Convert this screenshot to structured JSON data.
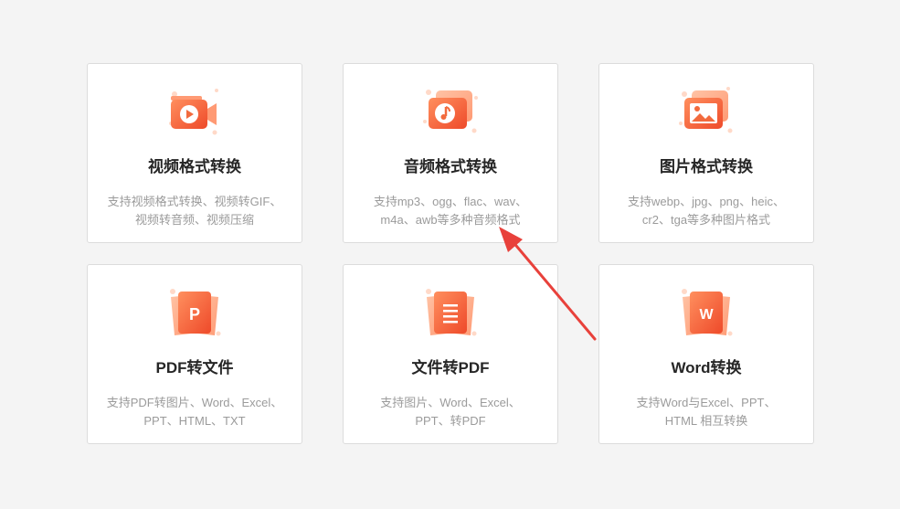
{
  "accent": "#f26a3d",
  "cards": [
    {
      "title": "视频格式转换",
      "desc": [
        "支持视频格式转换、视频转GIF、",
        "视频转音频、视频压缩"
      ],
      "icon": "video-icon"
    },
    {
      "title": "音频格式转换",
      "desc": [
        "支持mp3、ogg、flac、wav、",
        "m4a、awb等多种音频格式"
      ],
      "icon": "music-note-icon"
    },
    {
      "title": "图片格式转换",
      "desc": [
        "支持webp、jpg、png、heic、",
        "cr2、tga等多种图片格式"
      ],
      "icon": "image-icon"
    },
    {
      "title": "PDF转文件",
      "desc": [
        "支持PDF转图片、Word、Excel、",
        "PPT、HTML、TXT"
      ],
      "icon": "pdf-letter-icon",
      "letter": "P"
    },
    {
      "title": "文件转PDF",
      "desc": [
        "支持图片、Word、Excel、",
        "PPT、转PDF"
      ],
      "icon": "document-lines-icon"
    },
    {
      "title": "Word转换",
      "desc": [
        "支持Word与Excel、PPT、",
        "HTML 相互转换"
      ],
      "icon": "word-letter-icon",
      "letter": "W"
    }
  ]
}
